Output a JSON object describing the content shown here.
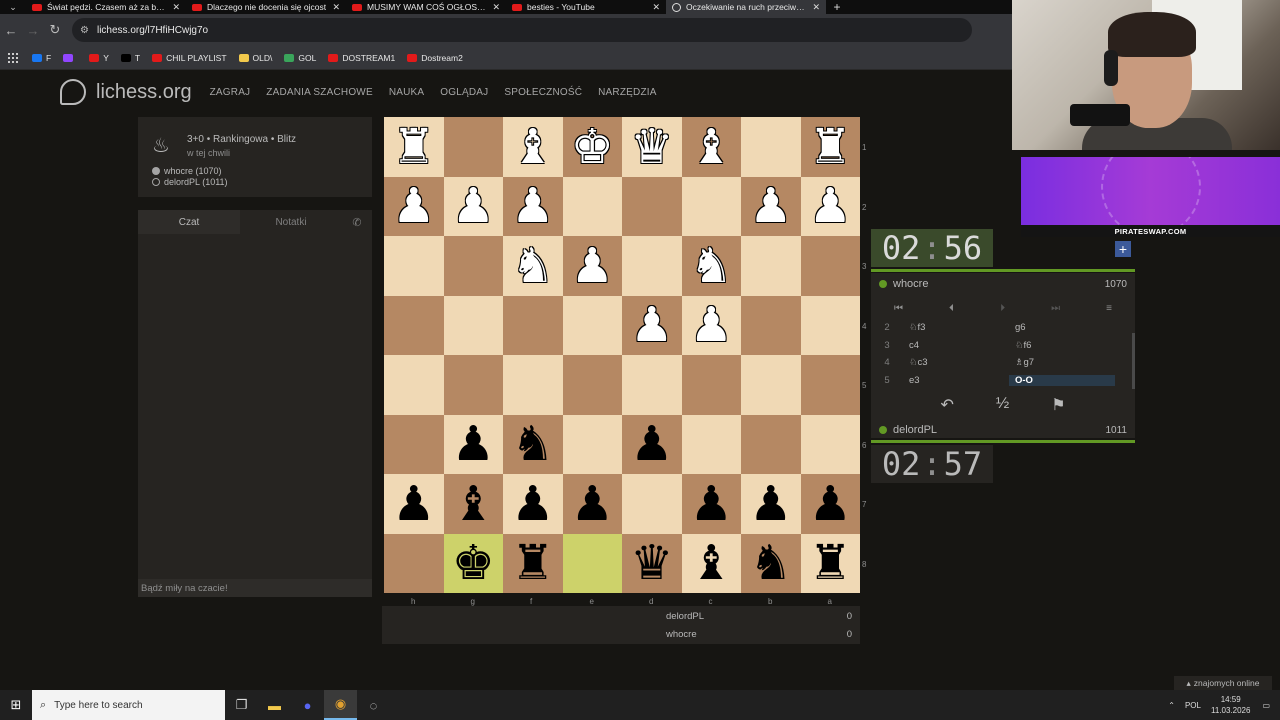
{
  "browser": {
    "tabs": [
      {
        "title": "Świat pędzi. Czasem aż za bard",
        "type": "youtube"
      },
      {
        "title": "Dlaczego nie docenia się ojcost",
        "type": "youtube"
      },
      {
        "title": "MUSIMY WAM COŚ OGŁOSIĆ...",
        "type": "youtube"
      },
      {
        "title": "besties - YouTube",
        "type": "youtube"
      },
      {
        "title": "Oczekiwanie na ruch przeciwnik",
        "type": "lichess",
        "active": true
      }
    ],
    "url": "lichess.org/l7HfiHCwjg7o",
    "bookmarks": [
      {
        "label": "F",
        "color": "#1877f2"
      },
      {
        "label": "",
        "color": "#9146ff"
      },
      {
        "label": "Y",
        "color": "#e21a1a"
      },
      {
        "label": "T",
        "color": "#000000"
      },
      {
        "label": "CHIL PLAYLIST",
        "color": "#e21a1a"
      },
      {
        "label": "OLD\\",
        "color": "#f2c94c"
      },
      {
        "label": "GOL",
        "color": "#3aa55b"
      },
      {
        "label": "DOSTREAM1",
        "color": "#e21a1a"
      },
      {
        "label": "Dostream2",
        "color": "#e21a1a"
      }
    ]
  },
  "site": {
    "logo": "lichess.org",
    "nav": [
      "ZAGRAJ",
      "ZADANIA SZACHOWE",
      "NAUKA",
      "OGLĄDAJ",
      "SPOŁECZNOŚĆ",
      "NARZĘDZIA"
    ]
  },
  "game": {
    "mode": "3+0 • Rankingowa • Blitz",
    "started": "w tej chwili",
    "white": "whocre (1070)",
    "black": "delordPL (1011)"
  },
  "chat": {
    "tab_chat": "Czat",
    "tab_notes": "Notatki",
    "placeholder": "Bądź miły na czacie!"
  },
  "board": {
    "orientation": "black",
    "ranks": [
      "1",
      "2",
      "3",
      "4",
      "5",
      "6",
      "7",
      "8"
    ],
    "files": [
      "h",
      "g",
      "f",
      "e",
      "d",
      "c",
      "b",
      "a"
    ],
    "rows": [
      [
        "wR",
        "",
        "wB",
        "wK",
        "wQ",
        "wB",
        "",
        "wR"
      ],
      [
        "wP",
        "wP",
        "wP",
        "",
        "",
        "",
        "wP",
        "wP"
      ],
      [
        "",
        "",
        "wN",
        "wP",
        "",
        "wN",
        "",
        ""
      ],
      [
        "",
        "",
        "",
        "",
        "wP",
        "wP",
        "",
        ""
      ],
      [
        "",
        "",
        "",
        "",
        "",
        "",
        "",
        ""
      ],
      [
        "",
        "bP",
        "bN",
        "",
        "bP",
        "",
        "",
        ""
      ],
      [
        "bP",
        "bB",
        "bP",
        "bP",
        "",
        "bP",
        "bP",
        "bP"
      ],
      [
        "",
        "bK",
        "bR",
        "",
        "bQ",
        "bB",
        "bN",
        "bR"
      ]
    ],
    "highlight": [
      [
        7,
        1
      ],
      [
        7,
        3
      ]
    ]
  },
  "scores": [
    {
      "name": "delordPL",
      "score": "0"
    },
    {
      "name": "whocre",
      "score": "0"
    }
  ],
  "top_player": {
    "name": "whocre",
    "rating": "1070",
    "clock_min": "02",
    "clock_sec": "56"
  },
  "bottom_player": {
    "name": "delordPL",
    "rating": "1011",
    "clock_min": "02",
    "clock_sec": "57"
  },
  "moves": [
    {
      "no": "2",
      "white": "♘f3",
      "black": "g6"
    },
    {
      "no": "3",
      "white": "c4",
      "black": "♘f6"
    },
    {
      "no": "4",
      "white": "♘c3",
      "black": "♗g7"
    },
    {
      "no": "5",
      "white": "e3",
      "black": "O-O",
      "current": true
    }
  ],
  "ad": {
    "text": "PIRATESWAP.COM"
  },
  "online": "znajomych online",
  "taskbar": {
    "search": "Type here to search",
    "lang": "POL",
    "time": "14:59",
    "date": "11.03.2026"
  }
}
